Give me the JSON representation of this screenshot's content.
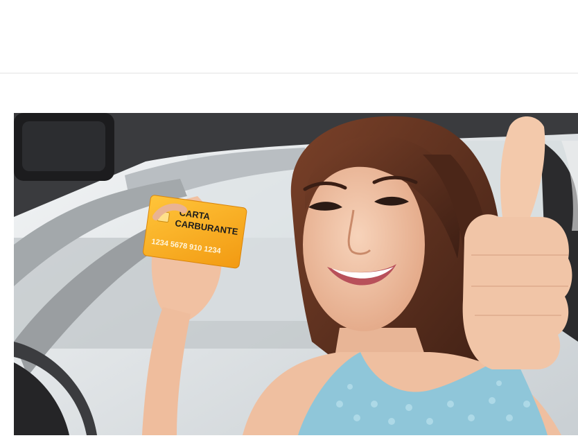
{
  "photo": {
    "subject": "smiling-woman-in-car-holding-fuel-card-thumbs-up",
    "card": {
      "title_line1": "CARTA",
      "title_line2": "CARBURANTE",
      "number": "1234 5678 910 1234",
      "color": "#f6a81b"
    },
    "colors": {
      "interior_dark": "#2a2a2c",
      "window_light": "#e9edf0",
      "skin": "#f1c4a6",
      "hair": "#5a2f1f",
      "top": "#8fc6d9"
    }
  }
}
